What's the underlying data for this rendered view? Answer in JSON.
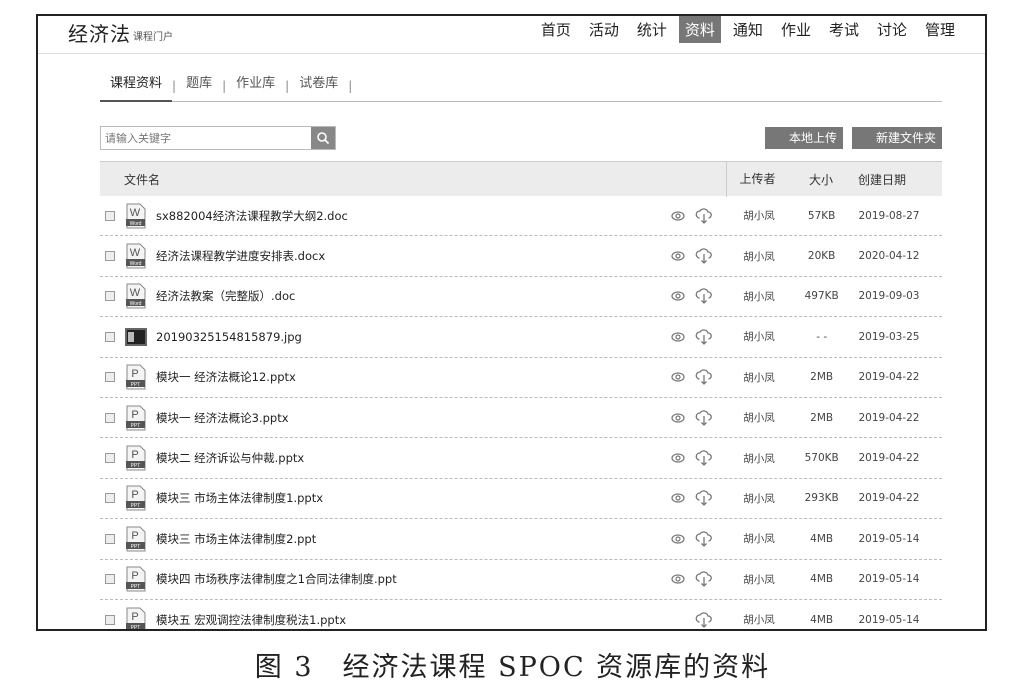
{
  "header": {
    "brand_title": "经济法",
    "brand_sub": "课程门户",
    "nav": [
      "首页",
      "活动",
      "统计",
      "资料",
      "通知",
      "作业",
      "考试",
      "讨论",
      "管理"
    ],
    "nav_active": 3
  },
  "tabs": [
    "课程资料",
    "题库",
    "作业库",
    "试卷库"
  ],
  "search": {
    "placeholder": "请输入关键字"
  },
  "buttons": {
    "upload": "本地上传",
    "new_folder": "新建文件夹"
  },
  "table": {
    "columns": {
      "name": "文件名",
      "uploader": "上传者",
      "size": "大小",
      "date": "创建日期"
    },
    "rows": [
      {
        "type": "word",
        "name": "sx882004经济法课程教学大纲2.doc",
        "uploader": "胡小凤",
        "size": "57KB",
        "date": "2019-08-27",
        "preview": true
      },
      {
        "type": "word",
        "name": "经济法课程教学进度安排表.docx",
        "uploader": "胡小凤",
        "size": "20KB",
        "date": "2020-04-12",
        "preview": true
      },
      {
        "type": "word",
        "name": "经济法教案（完整版）.doc",
        "uploader": "胡小凤",
        "size": "497KB",
        "date": "2019-09-03",
        "preview": true
      },
      {
        "type": "image",
        "name": "20190325154815879.jpg",
        "uploader": "胡小凤",
        "size": "- -",
        "date": "2019-03-25",
        "preview": true
      },
      {
        "type": "ppt",
        "name": "模块一 经济法概论12.pptx",
        "uploader": "胡小凤",
        "size": "2MB",
        "date": "2019-04-22",
        "preview": true
      },
      {
        "type": "ppt",
        "name": "模块一 经济法概论3.pptx",
        "uploader": "胡小凤",
        "size": "2MB",
        "date": "2019-04-22",
        "preview": true
      },
      {
        "type": "ppt",
        "name": "模块二 经济诉讼与仲裁.pptx",
        "uploader": "胡小凤",
        "size": "570KB",
        "date": "2019-04-22",
        "preview": true
      },
      {
        "type": "ppt",
        "name": "模块三 市场主体法律制度1.pptx",
        "uploader": "胡小凤",
        "size": "293KB",
        "date": "2019-04-22",
        "preview": true
      },
      {
        "type": "ppt",
        "name": "模块三 市场主体法律制度2.ppt",
        "uploader": "胡小凤",
        "size": "4MB",
        "date": "2019-05-14",
        "preview": true
      },
      {
        "type": "ppt",
        "name": "模块四 市场秩序法律制度之1合同法律制度.ppt",
        "uploader": "胡小凤",
        "size": "4MB",
        "date": "2019-05-14",
        "preview": true
      },
      {
        "type": "ppt",
        "name": "模块五 宏观调控法律制度税法1.pptx",
        "uploader": "胡小凤",
        "size": "4MB",
        "date": "2019-05-14",
        "preview": false
      }
    ]
  },
  "icon_labels": {
    "word_letter": "W",
    "word_tag": "Word",
    "ppt_letter": "P",
    "ppt_tag": "PPT"
  },
  "caption": "图 3　经济法课程 SPOC 资源库的资料"
}
